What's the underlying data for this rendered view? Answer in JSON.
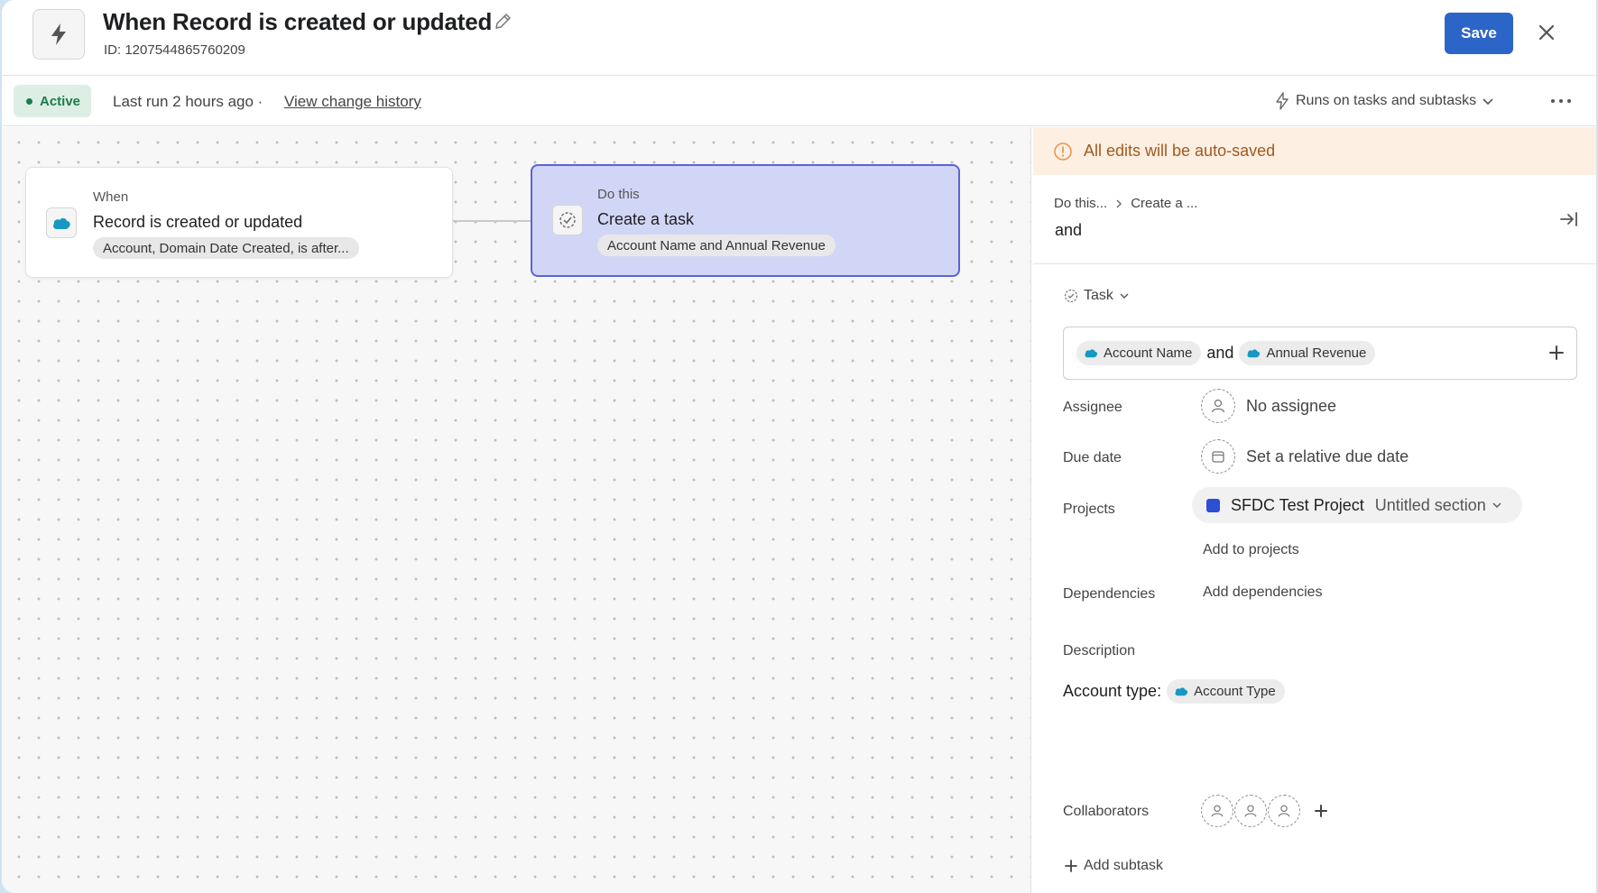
{
  "header": {
    "title": "When Record is created or updated",
    "rule_id": "ID: 1207544865760209",
    "save_label": "Save"
  },
  "subbar": {
    "status": "Active",
    "last_run": "Last run 2 hours ago ·",
    "history_link": "View change history",
    "runs_on": "Runs on tasks and subtasks"
  },
  "canvas": {
    "trigger": {
      "kicker": "When",
      "title": "Record is created or updated",
      "summary": "Account, Domain Date Created, is after..."
    },
    "action": {
      "kicker": "Do this",
      "title": "Create a task",
      "summary": "Account Name and Annual Revenue"
    }
  },
  "panel": {
    "autosave": "All edits will be auto-saved",
    "breadcrumb": [
      "Do this...",
      "Create a ..."
    ],
    "heading": "and",
    "task_type": "Task",
    "name_tokens": {
      "first": "Account Name",
      "joiner": "and",
      "second": "Annual Revenue"
    },
    "fields": {
      "assignee_label": "Assignee",
      "assignee_value": "No assignee",
      "due_label": "Due date",
      "due_value": "Set a relative due date",
      "projects_label": "Projects",
      "project_name": "SFDC Test Project",
      "project_section": "Untitled section",
      "add_to_projects": "Add to projects",
      "dependencies_label": "Dependencies",
      "add_dependencies": "Add dependencies",
      "description_label": "Description",
      "description_prefix": "Account type:",
      "description_token": "Account Type",
      "collaborators_label": "Collaborators",
      "add_subtask": "Add subtask"
    }
  },
  "colors": {
    "primary": "#2c65c8",
    "active_bg": "#ddefe5",
    "active_text": "#1e7a4b",
    "autosave_bg": "#fdefe2",
    "autosave_text": "#a05a1f",
    "selected_node_bg": "#d2d6f6",
    "selected_node_border": "#5b63d8",
    "project_color": "#2c4fd6",
    "salesforce_blue": "#1798c1"
  },
  "icons": {
    "rule": "lightning-bolt-icon",
    "edit": "pencil-icon",
    "close": "close-icon",
    "runs_on": "lightning-outline-icon",
    "more": "ellipsis-icon",
    "trigger": "salesforce-cloud-icon",
    "action": "check-circle-icon",
    "autosave": "info-circle-icon",
    "collapse": "collapse-right-icon"
  }
}
